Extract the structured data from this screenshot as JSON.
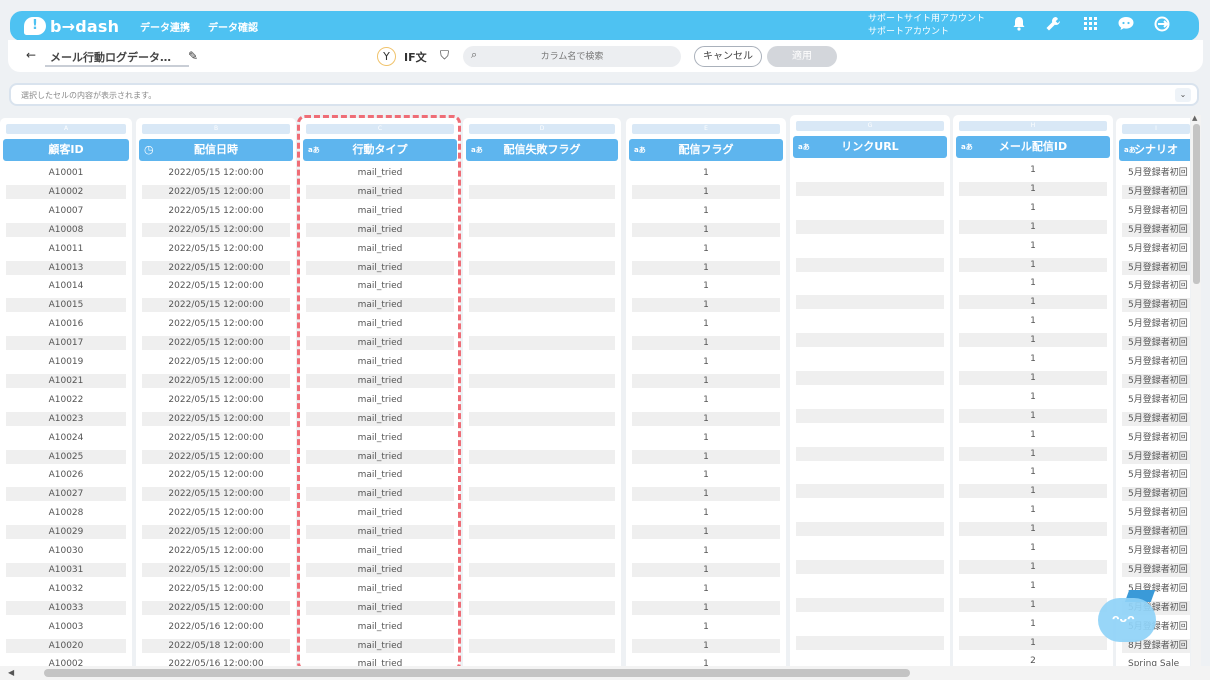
{
  "app": {
    "logo_mark": "!",
    "logo_text": "b→dash",
    "nav": [
      "データ連携",
      "データ確認"
    ],
    "account_line1": "サポートサイト用アカウント",
    "account_line2": "サポートアカウント",
    "brand_color": "#4ec2f2"
  },
  "subbar": {
    "back_label": "←",
    "title": "メール行動ログデータ…",
    "if_label": "IF文",
    "search_placeholder": "カラム名で検索",
    "cancel_label": "キャンセル",
    "apply_label": "適用"
  },
  "cellbar": {
    "placeholder": "選択したセルの内容が表示されます。"
  },
  "columns": [
    {
      "letter": "A",
      "header": "顧客ID",
      "icon": "",
      "align": "center"
    },
    {
      "letter": "B",
      "header": "配信日時",
      "icon": "clock-icon",
      "align": "center"
    },
    {
      "letter": "C",
      "header": "行動タイプ",
      "icon": "text-type-icon",
      "align": "center"
    },
    {
      "letter": "D",
      "header": "配信失敗フラグ",
      "icon": "text-type-icon",
      "align": "center"
    },
    {
      "letter": "E",
      "header": "配信フラグ",
      "icon": "text-type-icon",
      "align": "center"
    },
    {
      "letter": "G",
      "header": "リンクURL",
      "icon": "text-type-icon",
      "align": "center"
    },
    {
      "letter": "H",
      "header": "メール配信ID",
      "icon": "text-type-icon",
      "align": "center"
    },
    {
      "letter": "I",
      "header": "シナリオ",
      "icon": "text-type-icon",
      "align": "left"
    }
  ],
  "type_badge": "aあ",
  "rows": {
    "customer_ids": [
      "A10001",
      "A10002",
      "A10007",
      "A10008",
      "A10011",
      "A10013",
      "A10014",
      "A10015",
      "A10016",
      "A10017",
      "A10019",
      "A10021",
      "A10022",
      "A10023",
      "A10024",
      "A10025",
      "A10026",
      "A10027",
      "A10028",
      "A10029",
      "A10030",
      "A10031",
      "A10032",
      "A10033",
      "A10003",
      "A10020",
      "A10002"
    ],
    "dates": [
      "2022/05/15 12:00:00",
      "2022/05/15 12:00:00",
      "2022/05/15 12:00:00",
      "2022/05/15 12:00:00",
      "2022/05/15 12:00:00",
      "2022/05/15 12:00:00",
      "2022/05/15 12:00:00",
      "2022/05/15 12:00:00",
      "2022/05/15 12:00:00",
      "2022/05/15 12:00:00",
      "2022/05/15 12:00:00",
      "2022/05/15 12:00:00",
      "2022/05/15 12:00:00",
      "2022/05/15 12:00:00",
      "2022/05/15 12:00:00",
      "2022/05/15 12:00:00",
      "2022/05/15 12:00:00",
      "2022/05/15 12:00:00",
      "2022/05/15 12:00:00",
      "2022/05/15 12:00:00",
      "2022/05/15 12:00:00",
      "2022/05/15 12:00:00",
      "2022/05/15 12:00:00",
      "2022/05/15 12:00:00",
      "2022/05/16 12:00:00",
      "2022/05/18 12:00:00",
      "2022/05/16 12:00:00"
    ],
    "action_types": [
      "mail_tried",
      "mail_tried",
      "mail_tried",
      "mail_tried",
      "mail_tried",
      "mail_tried",
      "mail_tried",
      "mail_tried",
      "mail_tried",
      "mail_tried",
      "mail_tried",
      "mail_tried",
      "mail_tried",
      "mail_tried",
      "mail_tried",
      "mail_tried",
      "mail_tried",
      "mail_tried",
      "mail_tried",
      "mail_tried",
      "mail_tried",
      "mail_tried",
      "mail_tried",
      "mail_tried",
      "mail_tried",
      "mail_tried",
      "mail_tried"
    ],
    "fail_flags": [
      "",
      "",
      "",
      "",
      "",
      "",
      "",
      "",
      "",
      "",
      "",
      "",
      "",
      "",
      "",
      "",
      "",
      "",
      "",
      "",
      "",
      "",
      "",
      "",
      "",
      "",
      ""
    ],
    "delivery_flags": [
      "1",
      "1",
      "1",
      "1",
      "1",
      "1",
      "1",
      "1",
      "1",
      "1",
      "1",
      "1",
      "1",
      "1",
      "1",
      "1",
      "1",
      "1",
      "1",
      "1",
      "1",
      "1",
      "1",
      "1",
      "1",
      "1",
      "1"
    ],
    "link_urls": [
      "",
      "",
      "",
      "",
      "",
      "",
      "",
      "",
      "",
      "",
      "",
      "",
      "",
      "",
      "",
      "",
      "",
      "",
      "",
      "",
      "",
      "",
      "",
      "",
      "",
      "",
      ""
    ],
    "mail_ids": [
      "1",
      "1",
      "1",
      "1",
      "1",
      "1",
      "1",
      "1",
      "1",
      "1",
      "1",
      "1",
      "1",
      "1",
      "1",
      "1",
      "1",
      "1",
      "1",
      "1",
      "1",
      "1",
      "1",
      "1",
      "1",
      "1",
      "2"
    ],
    "scenarios": [
      "5月登録者初回",
      "5月登録者初回",
      "5月登録者初回",
      "5月登録者初回",
      "5月登録者初回",
      "5月登録者初回",
      "5月登録者初回",
      "5月登録者初回",
      "5月登録者初回",
      "5月登録者初回",
      "5月登録者初回",
      "5月登録者初回",
      "5月登録者初回",
      "5月登録者初回",
      "5月登録者初回",
      "5月登録者初回",
      "5月登録者初回",
      "5月登録者初回",
      "5月登録者初回",
      "5月登録者初回",
      "5月登録者初回",
      "5月登録者初回",
      "5月登録者初回",
      "5月登録者初回",
      "5月登録者初回",
      "8月登録者初回",
      "Spring Sale"
    ]
  }
}
